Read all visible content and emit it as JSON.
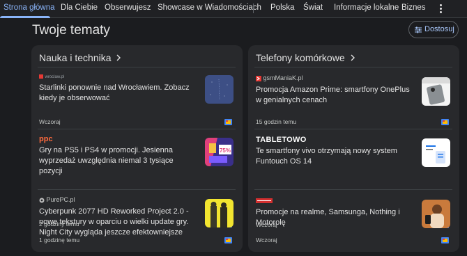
{
  "nav": {
    "tabs": [
      {
        "label": "Strona główna",
        "active": true
      },
      {
        "label": "Dla Ciebie"
      },
      {
        "label": "Obserwujesz"
      },
      {
        "label": "Showcase w Wiadomościach"
      },
      {
        "label": "Polska"
      },
      {
        "label": "Świat"
      },
      {
        "label": "Informacje lokalne"
      },
      {
        "label": "Biznes"
      }
    ],
    "more_icon": "more-vert-icon"
  },
  "header": {
    "title": "Twoje tematy",
    "customize_label": "Dostosuj",
    "customize_icon": "tune-icon"
  },
  "cards": [
    {
      "title": "Nauka i technika",
      "articles": [
        {
          "source": "wroclaw.pl",
          "headline": "Starlinki ponownie nad Wrocławiem. Zobacz kiedy je obserwować",
          "time": "Wczoraj"
        },
        {
          "source": "ppc",
          "headline": "Gry na PS5 i PS4 w promocji. Jesienna wyprzedaż uwzględnia niemal 3 tysiące pozycji",
          "time": "2 godziny temu"
        },
        {
          "source": "PurePC.pl",
          "headline": "Cyberpunk 2077 HD Reworked Project 2.0 - nowe tekstury w oparciu o wielki update gry. Night City wygląda jeszcze efektowniejsze",
          "time": "1 godzinę temu"
        }
      ]
    },
    {
      "title": "Telefony komórkowe",
      "articles": [
        {
          "source": "gsmManiaK.pl",
          "headline": "Promocja Amazon Prime: smartfony OnePlus w genialnych cenach",
          "time": "15 godzin temu"
        },
        {
          "source": "TABLETOWO",
          "headline": "Te smartfony vivo otrzymają nowy system Funtouch OS 14",
          "time": "Wczoraj"
        },
        {
          "source": "",
          "headline": "Promocje na realme, Samsunga, Nothing i Motorolę",
          "time": "Wczoraj"
        }
      ]
    }
  ],
  "thumb_texts": {
    "sale_badge": "75%"
  },
  "colors": {
    "background": "#1b1c1f",
    "card": "#28292c",
    "accent": "#8ab4f8",
    "text": "#e3e3e3"
  }
}
